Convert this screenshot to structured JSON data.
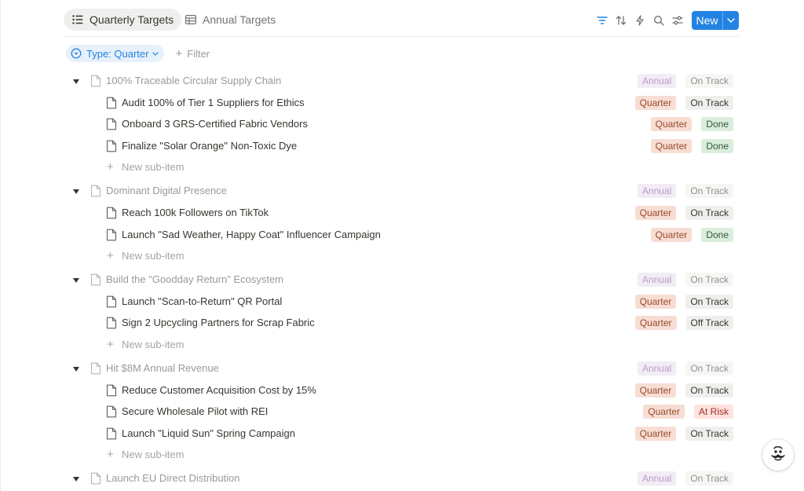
{
  "colors": {
    "accent": "#2383e2",
    "annual_bg": "#e8deee",
    "annual_fg": "#7c4f9a",
    "quarter_bg": "#f7ddd3",
    "quarter_fg": "#9a4a2a",
    "on_track_bg": "#efefed",
    "on_track_fg": "#37352f",
    "done_bg": "#dbeddb",
    "done_fg": "#2b593f",
    "off_track_bg": "#efefed",
    "off_track_fg": "#37352f",
    "at_risk_bg": "#ffe2dd",
    "at_risk_fg": "#9f3126"
  },
  "header": {
    "tabs": [
      {
        "label": "Quarterly Targets",
        "icon": "list-icon",
        "active": true
      },
      {
        "label": "Annual Targets",
        "icon": "table-icon",
        "active": false
      }
    ],
    "tools": [
      "filter-icon",
      "sort-icon",
      "lightning-icon",
      "search-icon",
      "settings-icon"
    ],
    "new_button": "New"
  },
  "filter": {
    "chip_label": "Type: Quarter",
    "add_label": "Filter"
  },
  "groups": [
    {
      "title": "100% Traceable Circular Supply Chain",
      "type": "Annual",
      "status": "On Track",
      "items": [
        {
          "title": "Audit 100% of Tier 1 Suppliers for Ethics",
          "type": "Quarter",
          "status": "On Track"
        },
        {
          "title": "Onboard 3 GRS-Certified Fabric Vendors",
          "type": "Quarter",
          "status": "Done"
        },
        {
          "title": "Finalize \"Solar Orange\" Non-Toxic Dye",
          "type": "Quarter",
          "status": "Done"
        }
      ],
      "new_sub_item": "New sub-item"
    },
    {
      "title": "Dominant Digital Presence",
      "type": "Annual",
      "status": "On Track",
      "items": [
        {
          "title": "Reach 100k Followers on TikTok",
          "type": "Quarter",
          "status": "On Track"
        },
        {
          "title": "Launch \"Sad Weather, Happy Coat\" Influencer Campaign",
          "type": "Quarter",
          "status": "Done"
        }
      ],
      "new_sub_item": "New sub-item"
    },
    {
      "title": "Build the \"Goodday Return\" Ecosystem",
      "type": "Annual",
      "status": "On Track",
      "items": [
        {
          "title": "Launch \"Scan-to-Return\" QR Portal",
          "type": "Quarter",
          "status": "On Track"
        },
        {
          "title": "Sign 2 Upcycling Partners for Scrap Fabric",
          "type": "Quarter",
          "status": "Off Track"
        }
      ],
      "new_sub_item": "New sub-item"
    },
    {
      "title": "Hit $8M Annual Revenue",
      "type": "Annual",
      "status": "On Track",
      "items": [
        {
          "title": "Reduce Customer Acquisition Cost by 15%",
          "type": "Quarter",
          "status": "On Track"
        },
        {
          "title": "Secure Wholesale Pilot with REI",
          "type": "Quarter",
          "status": "At Risk"
        },
        {
          "title": "Launch \"Liquid Sun\" Spring Campaign",
          "type": "Quarter",
          "status": "On Track"
        }
      ],
      "new_sub_item": "New sub-item"
    },
    {
      "title": "Launch EU Direct Distribution",
      "type": "Annual",
      "status": "On Track",
      "items": []
    }
  ],
  "help_avatar": "avatar-icon"
}
